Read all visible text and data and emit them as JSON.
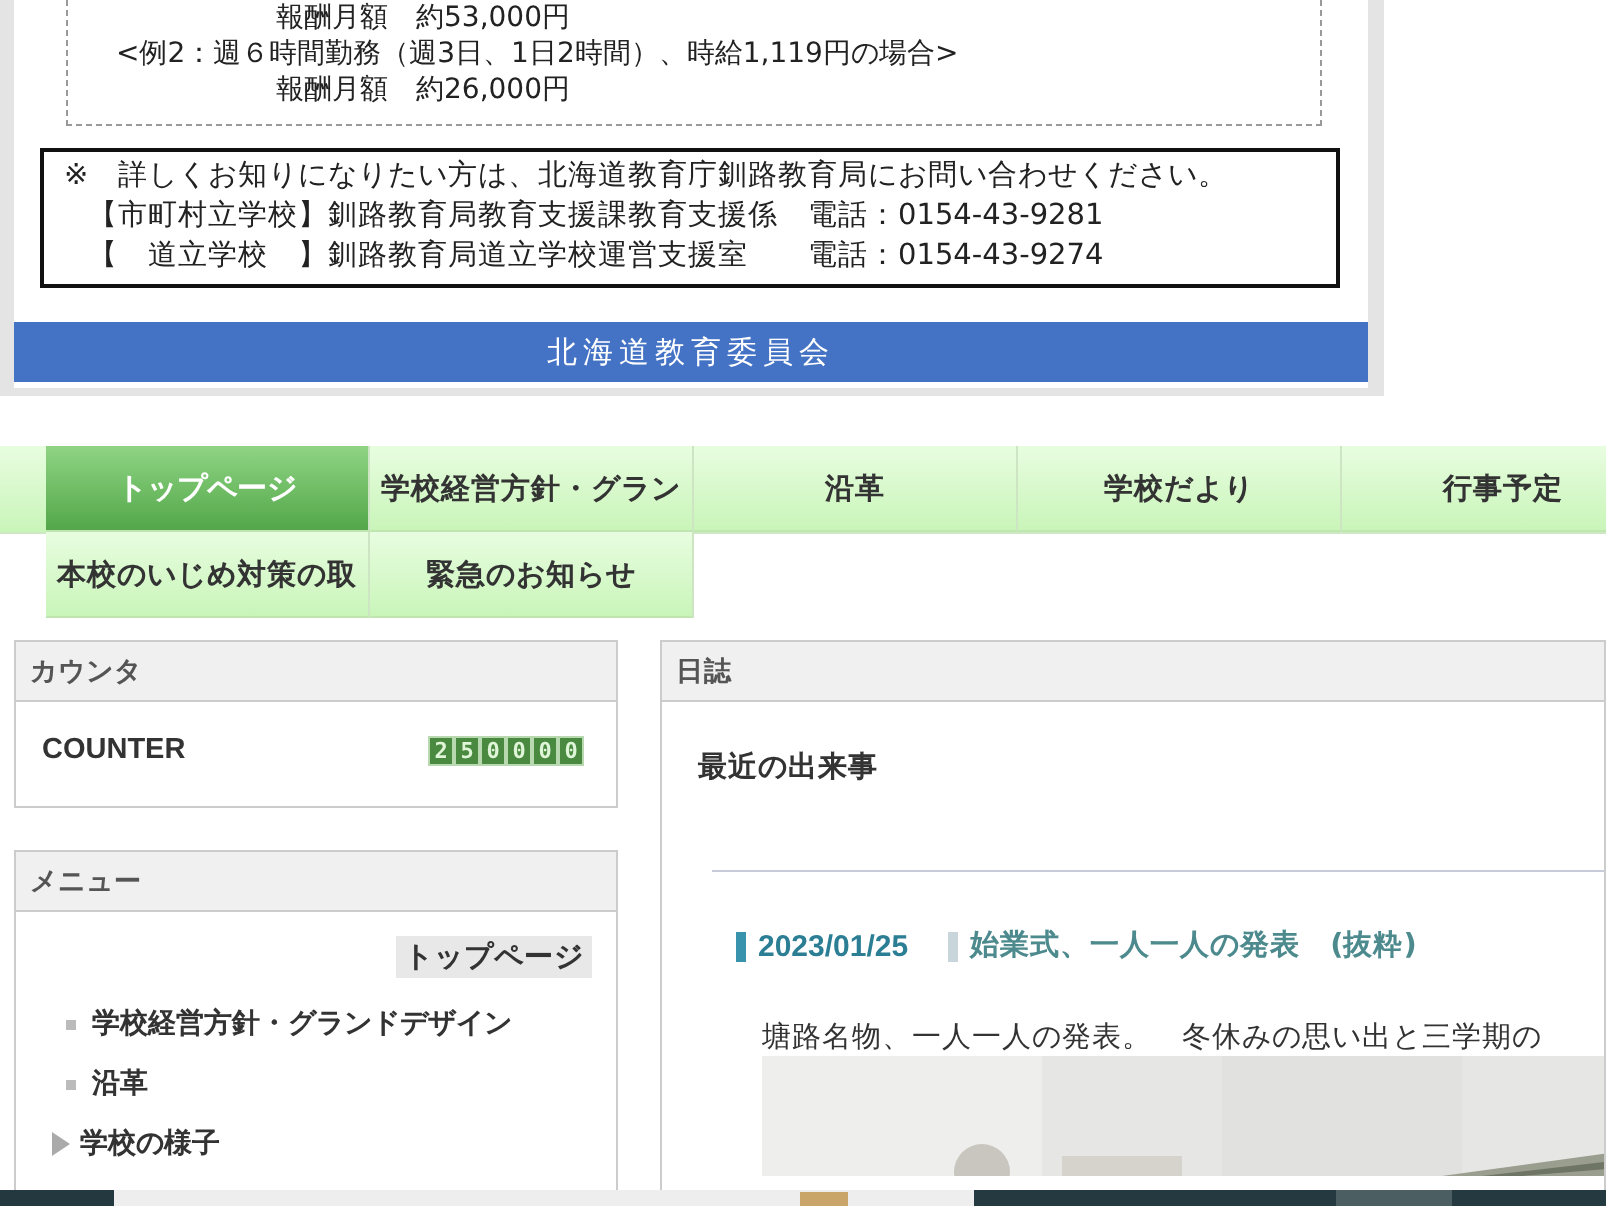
{
  "notice": {
    "example_lines": [
      {
        "kind": "amount",
        "text": "報酬月額　約53,000円"
      },
      {
        "kind": "case",
        "text": "<例2：週６時間勤務（週3日、1日2時間）、時給1,119円の場合>"
      },
      {
        "kind": "amount",
        "text": "報酬月額　約26,000円"
      }
    ],
    "contact_lines": [
      "※　詳しくお知りになりたい方は、北海道教育庁釧路教育局にお問い合わせください。",
      "【市町村立学校】釧路教育局教育支援課教育支援係　電話：0154-43-9281",
      "【　道立学校　】釧路教育局道立学校運営支援室　　電話：0154-43-9274"
    ],
    "footer": "北海道教育委員会"
  },
  "nav": [
    {
      "label": "トップページ",
      "selected": true
    },
    {
      "label": "学校経営方針・グラン",
      "selected": false
    },
    {
      "label": "沿革",
      "selected": false
    },
    {
      "label": "学校だより",
      "selected": false
    },
    {
      "label": "行事予定",
      "selected": false
    },
    {
      "label": "本校のいじめ対策の取",
      "selected": false
    },
    {
      "label": "緊急のお知らせ",
      "selected": false
    }
  ],
  "counter": {
    "title": "カウンタ",
    "label": "COUNTER",
    "digits": [
      "2",
      "5",
      "0",
      "0",
      "0",
      "0"
    ]
  },
  "menu": {
    "title": "メニュー",
    "items": [
      {
        "kind": "top",
        "label": "トップページ",
        "selected": true
      },
      {
        "kind": "page",
        "label": "学校経営方針・グランドデザイン",
        "selected": false
      },
      {
        "kind": "page",
        "label": "沿革",
        "selected": false
      },
      {
        "kind": "folder",
        "label": "学校の様子",
        "selected": false
      }
    ]
  },
  "diary": {
    "title": "日誌",
    "heading": "最近の出来事",
    "entry": {
      "date": "2023/01/25",
      "title": "始業式、一人一人の発表　(抜粋)",
      "body": "塘路名物、一人一人の発表。　冬休みの思い出と三学期の"
    }
  }
}
